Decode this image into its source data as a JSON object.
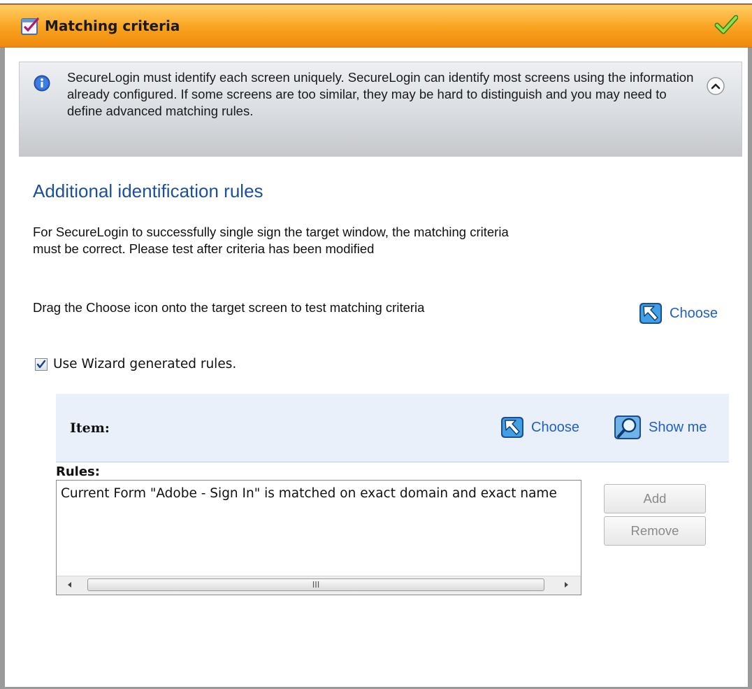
{
  "panel": {
    "title": "Matching criteria"
  },
  "info": {
    "text": "SecureLogin must identify each screen uniquely. SecureLogin can identify most screens using the information already configured. If some screens are too similar, they may be hard to distinguish and you may need to define advanced matching rules."
  },
  "section": {
    "title": "Additional identification rules",
    "description": "For SecureLogin to successfully single sign the target window, the matching criteria must be correct. Please test after criteria has been modified",
    "drag_instruction": "Drag the Choose icon onto the target screen to test matching criteria",
    "choose_label": "Choose"
  },
  "wizard_rules": {
    "label": "Use Wizard generated rules.",
    "checked": true
  },
  "item_bar": {
    "label": "Item:",
    "choose_label": "Choose",
    "show_me_label": "Show me"
  },
  "rules": {
    "label": "Rules:",
    "items": [
      "Current Form \"Adobe - Sign In\" is matched on exact domain and exact name"
    ],
    "scroll_thumb_glyph": "III"
  },
  "buttons": {
    "add": "Add",
    "remove": "Remove"
  },
  "colors": {
    "title_bar": "#f9a21f",
    "section_title": "#1c4f9c",
    "link": "#1f5fc7",
    "item_bar_bg": "#eaf0fa"
  },
  "icons": {
    "title": "checklist-icon",
    "status": "green-check-icon",
    "info": "info-icon",
    "collapse": "chevron-up-circle-icon",
    "choose": "choose-arrow-icon",
    "show_me": "magnifier-icon"
  }
}
